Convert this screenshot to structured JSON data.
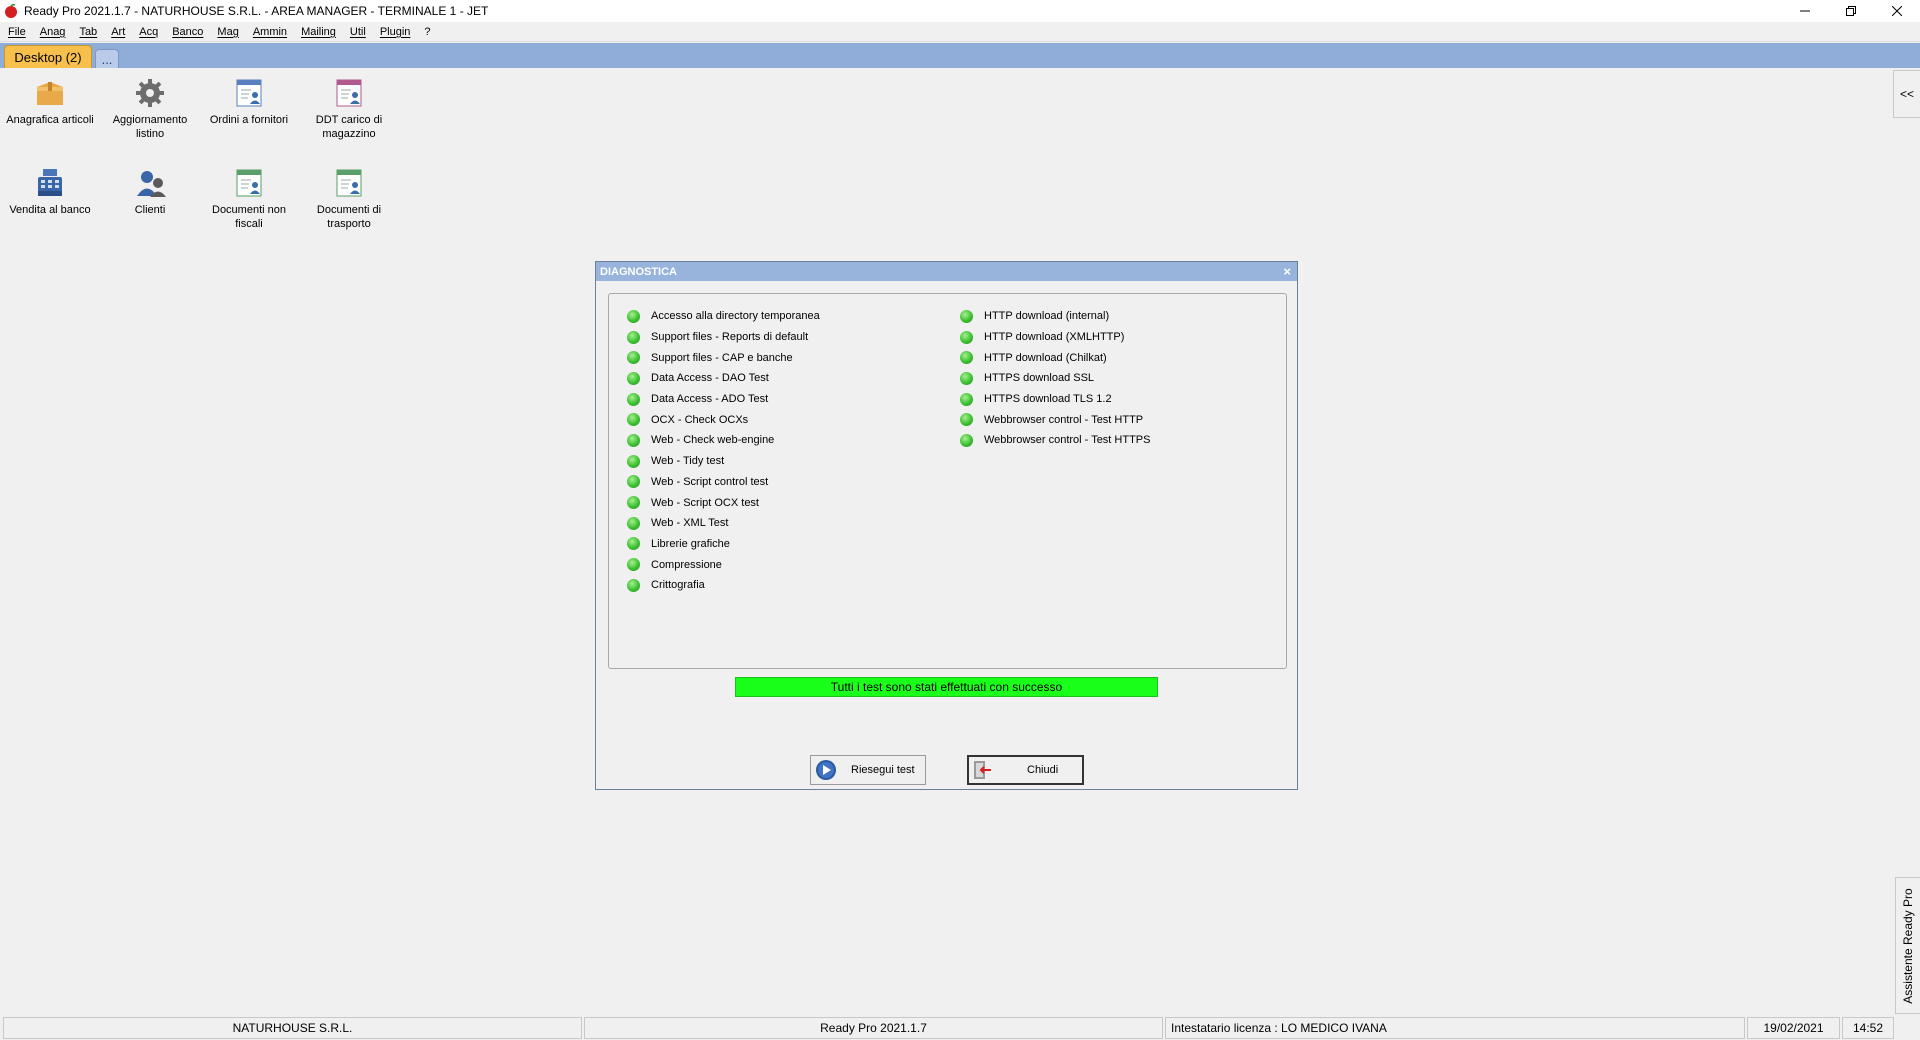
{
  "window": {
    "title": "Ready Pro 2021.1.7 - NATURHOUSE S.R.L. - AREA MANAGER - TERMINALE 1 - JET",
    "controls": [
      "minimize-icon",
      "restore-icon",
      "close-icon"
    ]
  },
  "menu": [
    "File",
    "Anag",
    "Tab",
    "Art",
    "Acq",
    "Banco",
    "Mag",
    "Ammin",
    "Mailing",
    "Util",
    "Plugin",
    "?"
  ],
  "tabs": {
    "desktop": "Desktop (2)",
    "more": "..."
  },
  "desktop_icons": [
    {
      "label": "Anagrafica articoli",
      "icon": "box-icon"
    },
    {
      "label": "Aggiornamento listino",
      "icon": "gear-icon"
    },
    {
      "label": "Ordini a fornitori",
      "icon": "document-user-icon"
    },
    {
      "label": "DDT carico di magazzino",
      "icon": "document-user-icon"
    },
    {
      "label": "Vendita al banco",
      "icon": "cash-register-icon"
    },
    {
      "label": "Clienti",
      "icon": "users-icon"
    },
    {
      "label": "Documenti non fiscali",
      "icon": "document-user-icon"
    },
    {
      "label": "Documenti di trasporto",
      "icon": "document-user-icon"
    }
  ],
  "side": {
    "collapse": "<<",
    "assistant": "Assistente Ready Pro"
  },
  "dialog": {
    "title": "DIAGNOSTICA",
    "close": "×",
    "tests_left": [
      "Accesso alla directory temporanea",
      "Support files - Reports di default",
      "Support files - CAP e banche",
      "Data Access - DAO Test",
      "Data Access - ADO Test",
      "OCX - Check OCXs",
      "Web - Check web-engine",
      "Web - Tidy test",
      "Web - Script control test",
      "Web - Script OCX test",
      "Web - XML Test",
      "Librerie grafiche",
      "Compressione",
      "Crittografia"
    ],
    "tests_right": [
      "HTTP download (internal)",
      "HTTP download (XMLHTTP)",
      "HTTP download (Chilkat)",
      "HTTPS download SSL",
      "HTTPS download TLS 1.2",
      "Webbrowser control - Test HTTP",
      "Webbrowser control - Test HTTPS"
    ],
    "status_message": "Tutti i test sono stati effettuati con successo",
    "rerun_label": "Riesegui test",
    "close_label": "Chiudi",
    "colors": {
      "pass": "#3cc031",
      "success_bar": "#1aff1a",
      "title_bg": "#98b4dc"
    }
  },
  "statusbar": {
    "company": "NATURHOUSE S.R.L.",
    "version": "Ready Pro 2021.1.7",
    "license": "Intestatario licenza : LO MEDICO IVANA",
    "date": "19/02/2021",
    "time": "14:52"
  }
}
